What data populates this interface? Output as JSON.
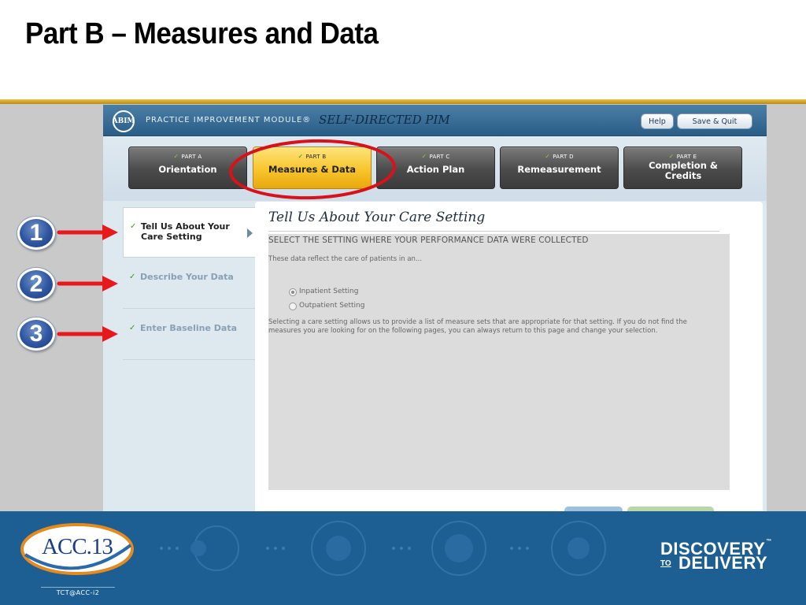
{
  "slide": {
    "title": "Part B – Measures and Data"
  },
  "app": {
    "logo_text": "ABIM",
    "title": "PRACTICE IMPROVEMENT MODULE®",
    "subtitle": "SELF-DIRECTED PIM",
    "help_label": "Help",
    "save_quit_label": "Save & Quit"
  },
  "tabs": [
    {
      "part": "PART A",
      "name": "Orientation",
      "active": false
    },
    {
      "part": "PART B",
      "name": "Measures & Data",
      "active": true
    },
    {
      "part": "PART C",
      "name": "Action Plan",
      "active": false
    },
    {
      "part": "PART D",
      "name": "Remeasurement",
      "active": false
    },
    {
      "part": "PART E",
      "name": "Completion & Credits",
      "active": false
    }
  ],
  "nav": [
    {
      "label": "Tell Us About Your Care Setting",
      "active": true
    },
    {
      "label": "Describe Your Data",
      "active": false
    },
    {
      "label": "Enter Baseline Data",
      "active": false
    }
  ],
  "content": {
    "title": "Tell Us About Your Care Setting",
    "section_header": "SELECT THE SETTING WHERE YOUR PERFORMANCE DATA WERE COLLECTED",
    "intro": "These data reflect the care of patients in an...",
    "options": [
      {
        "label": "Inpatient Setting",
        "selected": true
      },
      {
        "label": "Outpatient Setting",
        "selected": false
      }
    ],
    "note": "Selecting a care setting allows us to provide a list of measure sets that are appropriate for that setting. If you do not find the measures you are looking for on the following pages, you can always return to this page and change your selection."
  },
  "callouts": [
    "1",
    "2",
    "3"
  ],
  "colors": {
    "callout_arrow": "#e8191d",
    "highlight_ring": "#d8121b",
    "active_tab": "#f6c227",
    "footer": "#1d5f92",
    "gold_rule": "#d4a82c"
  },
  "footer": {
    "acc_logo": "ACC.13",
    "acc_tag": "TCT@ACC-i2",
    "brand_top": "DISCOVERY",
    "brand_to": "TO",
    "brand_bottom": "DELIVERY"
  }
}
